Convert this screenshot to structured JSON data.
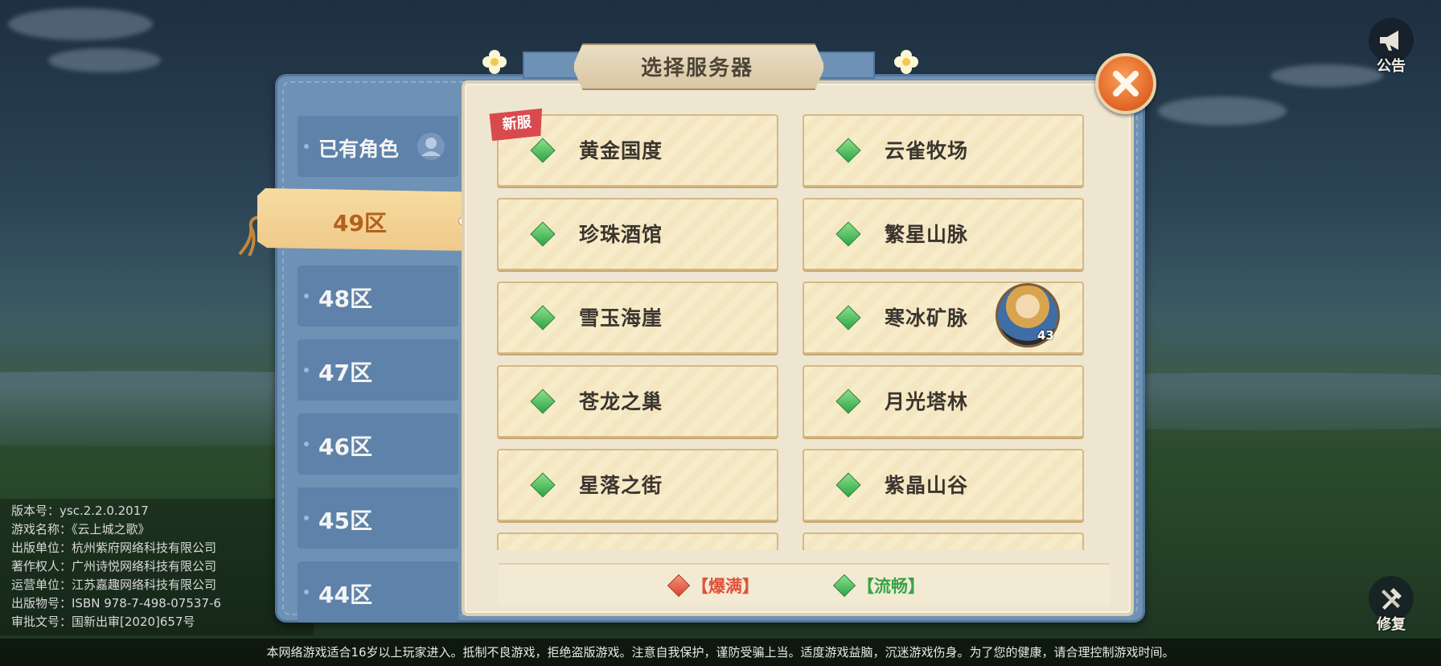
{
  "top_buttons": {
    "announcement_label": "公告",
    "repair_label": "修复"
  },
  "dialog": {
    "title": "选择服务器",
    "close_icon": "close-x"
  },
  "zone_tabs": [
    {
      "label": "已有角色",
      "icon": "player-head-icon",
      "selected": false
    },
    {
      "label": "49区",
      "selected": true
    },
    {
      "label": "48区",
      "selected": false
    },
    {
      "label": "47区",
      "selected": false
    },
    {
      "label": "46区",
      "selected": false
    },
    {
      "label": "45区",
      "selected": false
    },
    {
      "label": "44区",
      "selected": false
    }
  ],
  "servers": [
    {
      "name": "黄金国度",
      "status": "流畅",
      "tag": "新服"
    },
    {
      "name": "云雀牧场",
      "status": "流畅"
    },
    {
      "name": "珍珠酒馆",
      "status": "流畅"
    },
    {
      "name": "繁星山脉",
      "status": "流畅"
    },
    {
      "name": "雪玉海崖",
      "status": "流畅"
    },
    {
      "name": "寒冰矿脉",
      "status": "流畅",
      "character_level": "43"
    },
    {
      "name": "苍龙之巢",
      "status": "流畅"
    },
    {
      "name": "月光塔林",
      "status": "流畅"
    },
    {
      "name": "星落之街",
      "status": "流畅"
    },
    {
      "name": "紫晶山谷",
      "status": "流畅"
    }
  ],
  "legend": {
    "full": {
      "label": "【爆满】",
      "color": "#e0523a"
    },
    "smooth": {
      "label": "【流畅】",
      "color": "#3aa34a"
    }
  },
  "info": {
    "version": "版本号：ysc.2.2.0.2017",
    "game_name": "游戏名称：《云上城之歌》",
    "publisher": "出版单位：杭州紫府网络科技有限公司",
    "copyright": "著作权人：广州诗悦网络科技有限公司",
    "operator": "运营单位：江苏嘉趣网络科技有限公司",
    "isbn": "出版物号：ISBN 978-7-498-07537-6",
    "approval": "审批文号：国新出审[2020]657号"
  },
  "health_notice": "本网络游戏适合16岁以上玩家进入。抵制不良游戏，拒绝盗版游戏。注意自我保护，谨防受骗上当。适度游戏益脑，沉迷游戏伤身。为了您的健康，请合理控制游戏时间。"
}
